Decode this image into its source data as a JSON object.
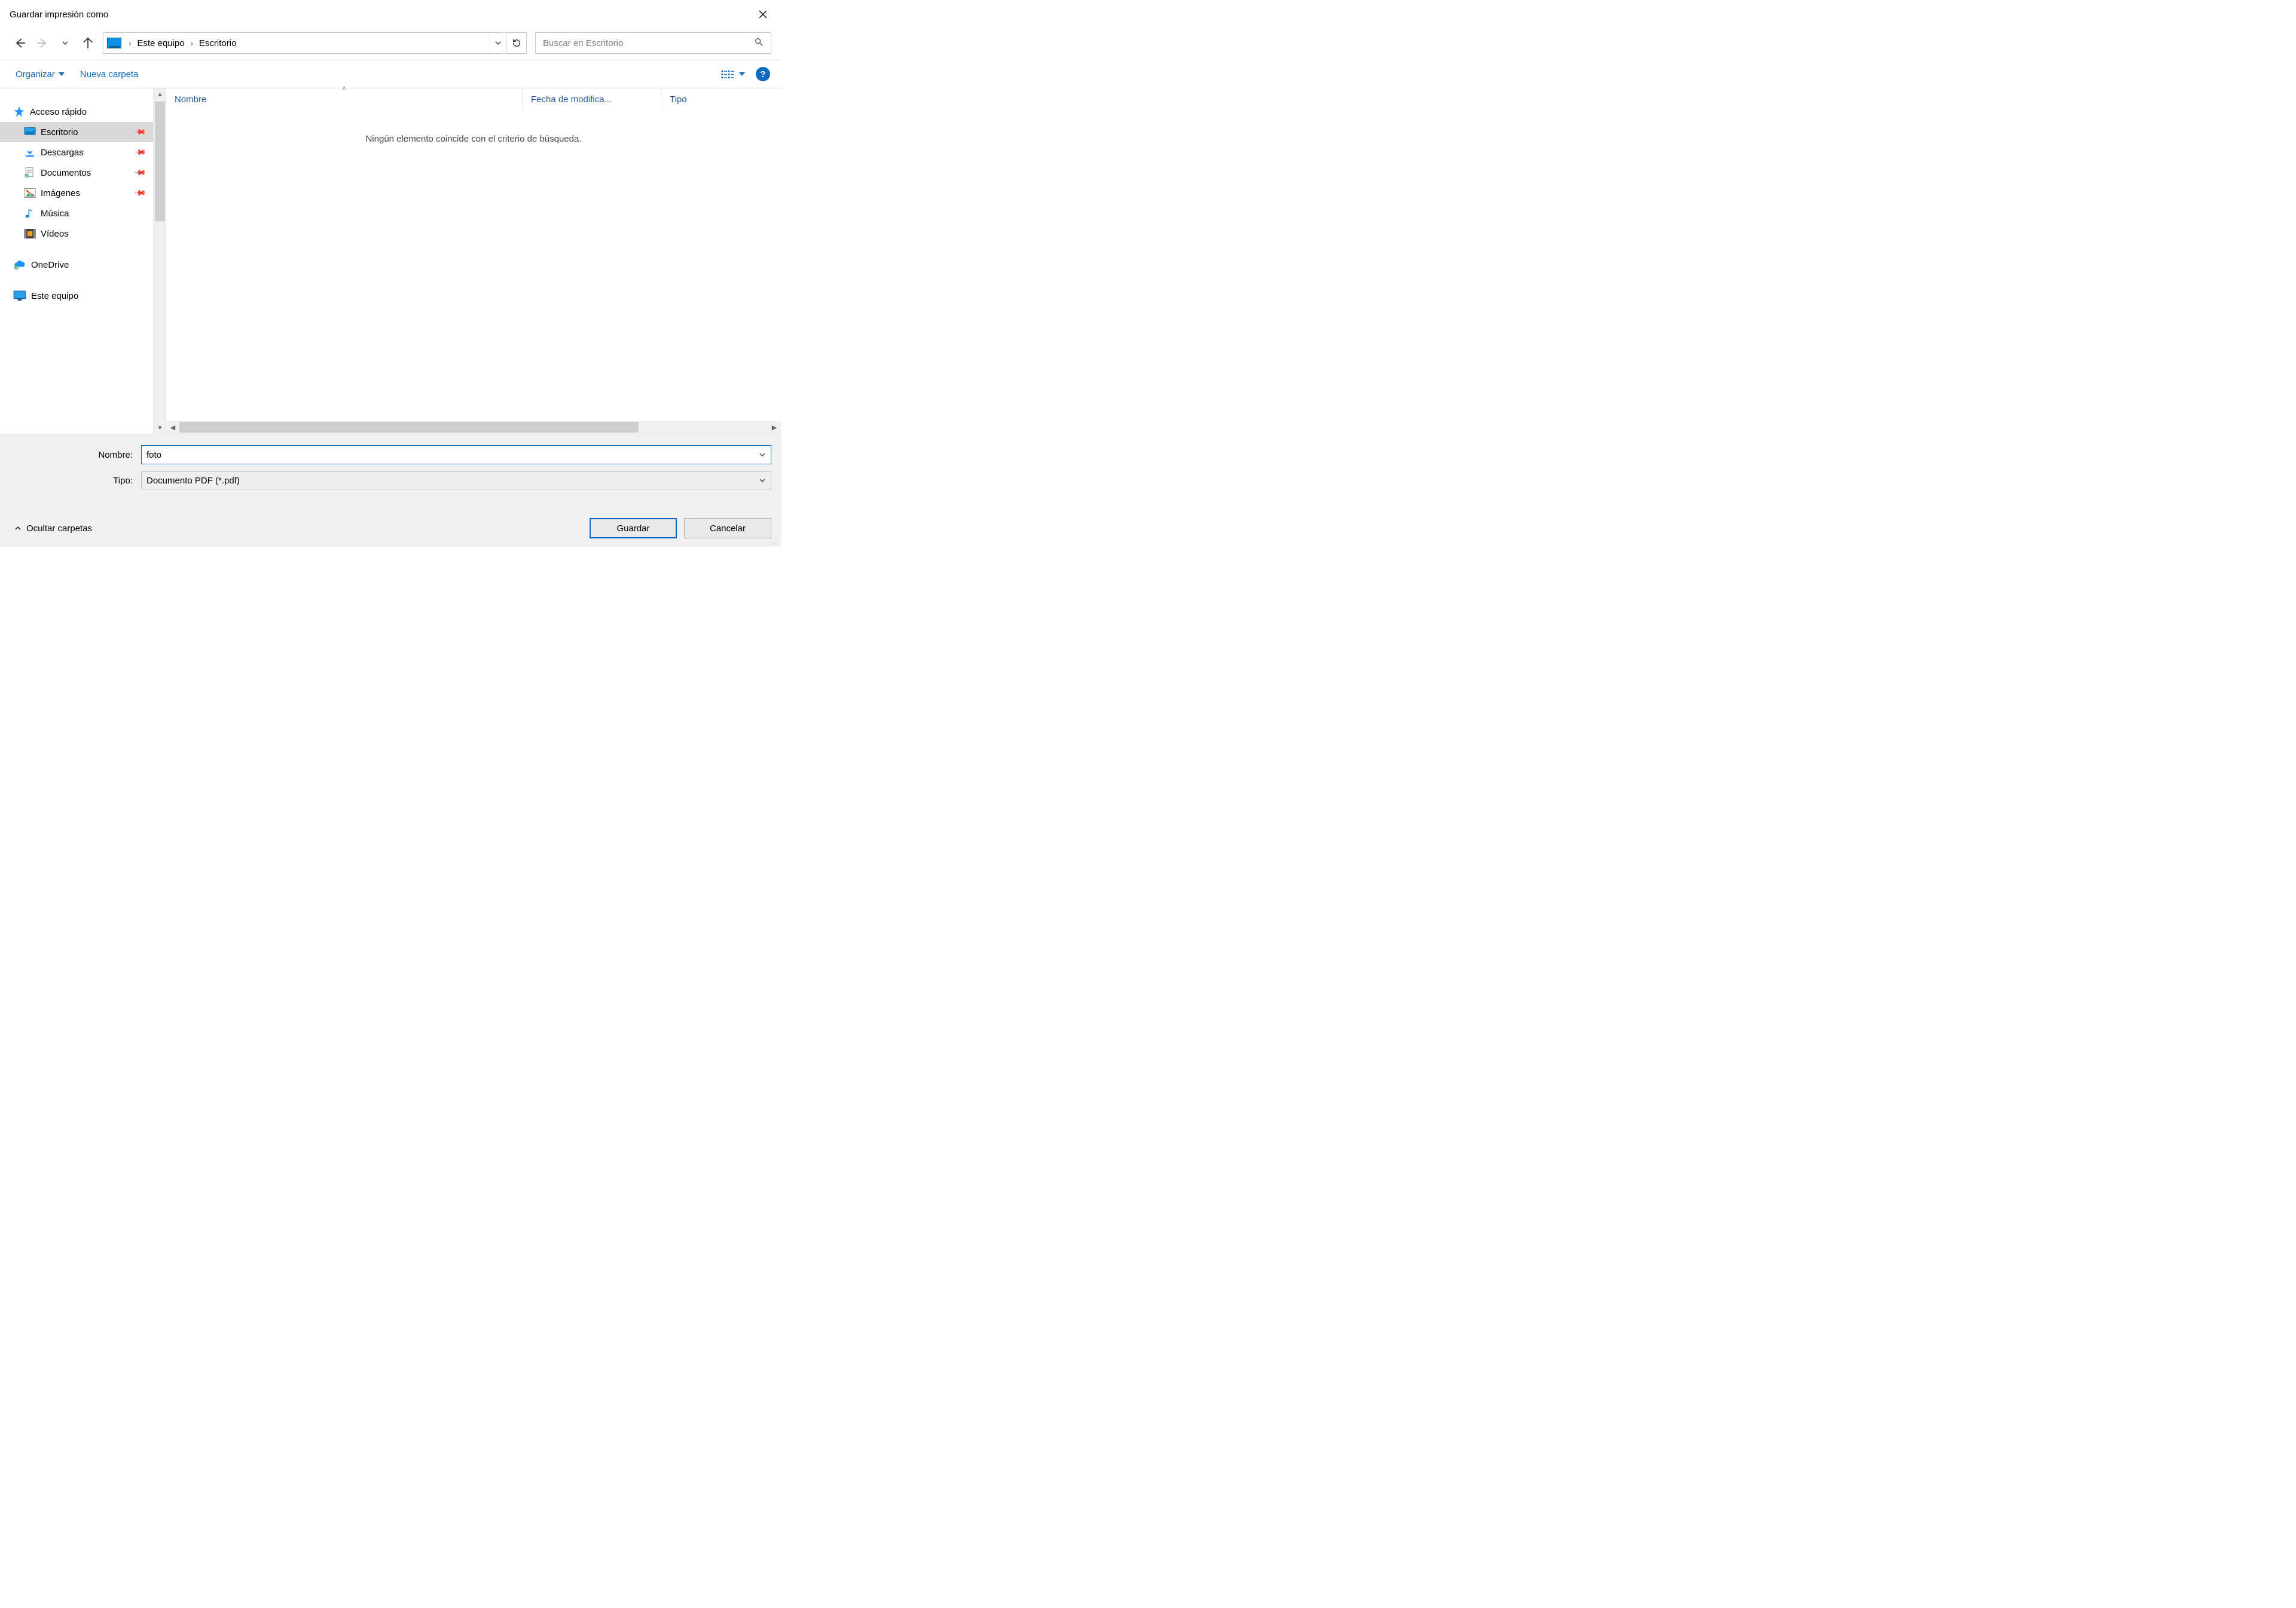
{
  "title": "Guardar impresión como",
  "nav": {
    "breadcrumbs": [
      "Este equipo",
      "Escritorio"
    ]
  },
  "search": {
    "placeholder": "Buscar en Escritorio"
  },
  "toolbar": {
    "organize": "Organizar",
    "new_folder": "Nueva carpeta"
  },
  "tree": {
    "quick_access": "Acceso rápido",
    "items": [
      {
        "label": "Escritorio",
        "icon": "desktop",
        "pinned": true,
        "selected": true
      },
      {
        "label": "Descargas",
        "icon": "download",
        "pinned": true
      },
      {
        "label": "Documentos",
        "icon": "documents",
        "pinned": true
      },
      {
        "label": "Imágenes",
        "icon": "images",
        "pinned": true
      },
      {
        "label": "Música",
        "icon": "music"
      },
      {
        "label": "Vídeos",
        "icon": "videos"
      }
    ],
    "onedrive": "OneDrive",
    "this_pc": "Este equipo"
  },
  "columns": {
    "name": "Nombre",
    "date": "Fecha de modifica...",
    "type": "Tipo"
  },
  "empty_message": "Ningún elemento coincide con el criterio de búsqueda.",
  "fields": {
    "name_label": "Nombre:",
    "name_value": "foto",
    "type_label": "Tipo:",
    "type_value": "Documento PDF (*.pdf)"
  },
  "footer": {
    "hide_folders": "Ocultar carpetas",
    "save": "Guardar",
    "cancel": "Cancelar"
  }
}
